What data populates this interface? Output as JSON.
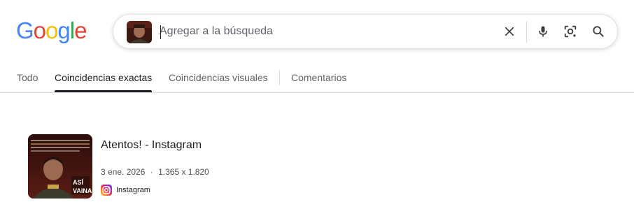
{
  "logo": {
    "letters": [
      "G",
      "o",
      "o",
      "g",
      "l",
      "e"
    ],
    "colors": [
      "#4285F4",
      "#EA4335",
      "#FBBC05",
      "#4285F4",
      "#34A853",
      "#EA4335"
    ]
  },
  "search": {
    "placeholder": "Agregar a la búsqueda",
    "value": ""
  },
  "tabs": [
    {
      "label": "Todo",
      "active": false
    },
    {
      "label": "Coincidencias exactas",
      "active": true
    },
    {
      "label": "Coincidencias visuales",
      "active": false
    },
    {
      "label": "Comentarios",
      "active": false
    }
  ],
  "result": {
    "title": "Atentos! - Instagram",
    "date": "3 ene. 2026",
    "separator": "·",
    "dimensions": "1.365 x 1.820",
    "source": "Instagram",
    "thumb_text": "Según reportes, el comandante de las fuerzas armadas, Vladimir Padrino López, habría fallecido en el operativo",
    "thumb_brand_top": "ASÍ",
    "thumb_brand_bottom": "VAINA"
  },
  "icons": {
    "clear": "close-icon",
    "voice": "microphone-icon",
    "lens": "camera-lens-icon",
    "search": "search-icon",
    "source": "instagram-icon"
  }
}
